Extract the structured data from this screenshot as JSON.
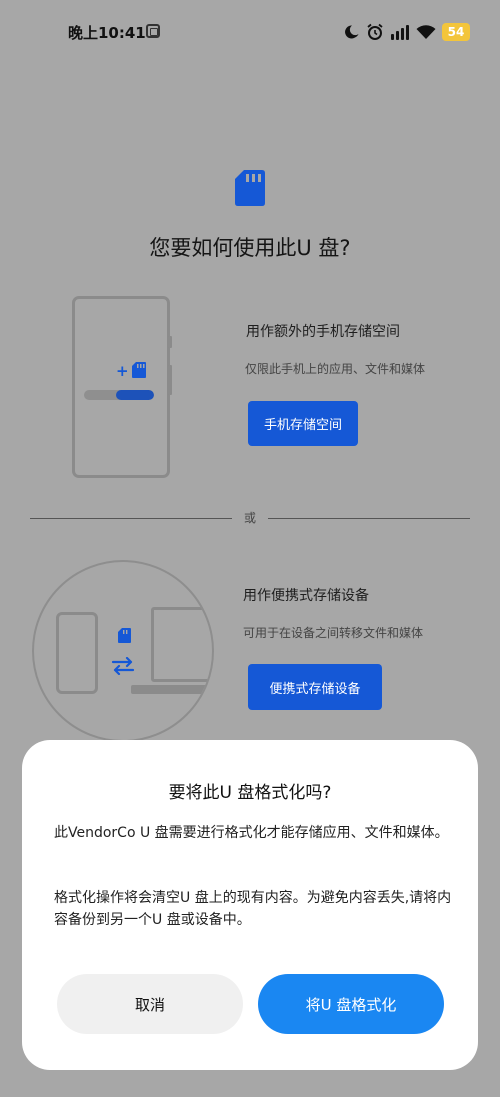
{
  "status_bar": {
    "time": "晚上10:41",
    "battery": "54",
    "icons": [
      "app-notification-icon",
      "moon-icon",
      "alarm-icon",
      "signal-icon",
      "wifi-icon",
      "battery-icon"
    ]
  },
  "header": {
    "icon": "sd-card-icon",
    "title": "您要如何使用此U 盘?"
  },
  "options": [
    {
      "heading": "用作额外的手机存储空间",
      "caption": "仅限此手机上的应用、文件和媒体",
      "button": "手机存储空间",
      "progress": 0.55
    },
    {
      "heading": "用作便携式存储设备",
      "caption": "可用于在设备之间转移文件和媒体",
      "button": "便携式存储设备"
    }
  ],
  "divider_label": "或",
  "dialog": {
    "title": "要将此U 盘格式化吗?",
    "paragraph1": "此VendorCo U 盘需要进行格式化才能存储应用、文件和媒体。",
    "paragraph2": "格式化操作将会清空U 盘上的现有内容。为避免内容丢失,请将内容备份到另一个U 盘或设备中。",
    "cancel": "取消",
    "confirm": "将U 盘格式化"
  },
  "colors": {
    "scrim": "#a7a7a7",
    "accent": "#1558d6",
    "confirm": "#1a87f2",
    "cancel_bg": "#f0f0f0",
    "battery": "#f3c53b"
  }
}
